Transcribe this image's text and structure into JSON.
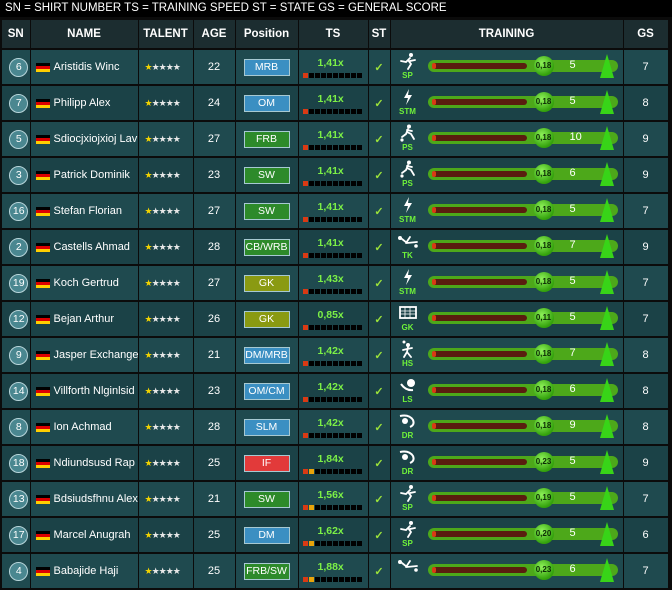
{
  "legend": "SN = SHIRT NUMBER    TS = TRAINING SPEED    ST = STATE    GS = GENERAL SCORE",
  "headers": {
    "sn": "SN",
    "name": "NAME",
    "talent": "TALENT",
    "age": "AGE",
    "position": "Position",
    "ts": "TS",
    "st": "ST",
    "training": "TRAINING",
    "gs": "GS"
  },
  "colors": {
    "pos_blue": "#3b8fc2",
    "pos_green": "#2d8a2a",
    "pos_olive": "#8a9a12",
    "pos_red": "#e23a3a"
  },
  "players": [
    {
      "sn": "6",
      "name": "Aristidis Winc",
      "talent": 1,
      "age": "22",
      "position": "MRB",
      "pos_color": "blue",
      "ts": "1,41x",
      "ts_level": 1,
      "train_icon": "running-icon",
      "train_code": "SP",
      "train_value": "0,18",
      "train_progress": 0.05,
      "train_level": "5",
      "gs": "7"
    },
    {
      "sn": "7",
      "name": "Philipp Alex",
      "talent": 1,
      "age": "24",
      "position": "OM",
      "pos_color": "blue",
      "ts": "1,41x",
      "ts_level": 1,
      "train_icon": "lightning-icon",
      "train_code": "STM",
      "train_value": "0,18",
      "train_progress": 0.05,
      "train_level": "5",
      "gs": "8"
    },
    {
      "sn": "5",
      "name": "Sdiocjxiojxioj Lav",
      "talent": 1,
      "age": "27",
      "position": "FRB",
      "pos_color": "green",
      "ts": "1,41x",
      "ts_level": 1,
      "train_icon": "passing-icon",
      "train_code": "PS",
      "train_value": "0,18",
      "train_progress": 0.05,
      "train_level": "10",
      "gs": "9"
    },
    {
      "sn": "3",
      "name": "Patrick Dominik",
      "talent": 1,
      "age": "23",
      "position": "SW",
      "pos_color": "green",
      "ts": "1,41x",
      "ts_level": 1,
      "train_icon": "passing-icon",
      "train_code": "PS",
      "train_value": "0,18",
      "train_progress": 0.05,
      "train_level": "6",
      "gs": "9"
    },
    {
      "sn": "16",
      "name": "Stefan Florian",
      "talent": 1,
      "age": "27",
      "position": "SW",
      "pos_color": "green",
      "ts": "1,41x",
      "ts_level": 1,
      "train_icon": "lightning-icon",
      "train_code": "STM",
      "train_value": "0,18",
      "train_progress": 0.05,
      "train_level": "5",
      "gs": "7"
    },
    {
      "sn": "2",
      "name": "Castells Ahmad",
      "talent": 1,
      "age": "28",
      "position": "CB/WRB",
      "pos_color": "green",
      "ts": "1,41x",
      "ts_level": 1,
      "train_icon": "tackle-icon",
      "train_code": "TK",
      "train_value": "0,18",
      "train_progress": 0.05,
      "train_level": "7",
      "gs": "9"
    },
    {
      "sn": "19",
      "name": "Koch Gertrud",
      "talent": 1,
      "age": "27",
      "position": "GK",
      "pos_color": "olive",
      "ts": "1,43x",
      "ts_level": 1,
      "train_icon": "lightning-icon",
      "train_code": "STM",
      "train_value": "0,18",
      "train_progress": 0.05,
      "train_level": "5",
      "gs": "7"
    },
    {
      "sn": "12",
      "name": "Bejan Arthur",
      "talent": 1,
      "age": "26",
      "position": "GK",
      "pos_color": "olive",
      "ts": "0,85x",
      "ts_level": 1,
      "train_icon": "goal-icon",
      "train_code": "GK",
      "train_value": "0,11",
      "train_progress": 0.05,
      "train_level": "5",
      "gs": "7"
    },
    {
      "sn": "9",
      "name": "Jasper Exchange",
      "talent": 1,
      "age": "21",
      "position": "DM/MRB",
      "pos_color": "blue",
      "ts": "1,42x",
      "ts_level": 1,
      "train_icon": "header-icon",
      "train_code": "HS",
      "train_value": "0,18",
      "train_progress": 0.05,
      "train_level": "7",
      "gs": "8"
    },
    {
      "sn": "14",
      "name": "Villforth Nlginlsid",
      "talent": 1,
      "age": "23",
      "position": "OM/CM",
      "pos_color": "blue",
      "ts": "1,42x",
      "ts_level": 1,
      "train_icon": "longshot-icon",
      "train_code": "LS",
      "train_value": "0,18",
      "train_progress": 0.05,
      "train_level": "6",
      "gs": "8"
    },
    {
      "sn": "8",
      "name": "Ion Achmad",
      "talent": 1,
      "age": "28",
      "position": "SLM",
      "pos_color": "blue",
      "ts": "1,42x",
      "ts_level": 1,
      "train_icon": "dribbling-icon",
      "train_code": "DR",
      "train_value": "0,18",
      "train_progress": 0.05,
      "train_level": "9",
      "gs": "8"
    },
    {
      "sn": "18",
      "name": "Ndiundsusd Rap",
      "talent": 1,
      "age": "25",
      "position": "IF",
      "pos_color": "red",
      "ts": "1,84x",
      "ts_level": 2,
      "train_icon": "dribbling-icon",
      "train_code": "DR",
      "train_value": "0,23",
      "train_progress": 0.05,
      "train_level": "5",
      "gs": "9"
    },
    {
      "sn": "13",
      "name": "Bdsiudsfhnu Alex",
      "talent": 1,
      "age": "21",
      "position": "SW",
      "pos_color": "green",
      "ts": "1,56x",
      "ts_level": 2,
      "train_icon": "running-icon",
      "train_code": "SP",
      "train_value": "0,19",
      "train_progress": 0.05,
      "train_level": "5",
      "gs": "7"
    },
    {
      "sn": "17",
      "name": "Marcel Anugrah",
      "talent": 1,
      "age": "25",
      "position": "DM",
      "pos_color": "blue",
      "ts": "1,62x",
      "ts_level": 2,
      "train_icon": "running-icon",
      "train_code": "SP",
      "train_value": "0,20",
      "train_progress": 0.05,
      "train_level": "5",
      "gs": "6"
    },
    {
      "sn": "4",
      "name": "Babajide Haji",
      "talent": 1,
      "age": "25",
      "position": "FRB/SW",
      "pos_color": "green",
      "ts": "1,88x",
      "ts_level": 2,
      "train_icon": "tackle-icon",
      "train_code": "",
      "train_value": "0,23",
      "train_progress": 0.05,
      "train_level": "6",
      "gs": "7"
    }
  ]
}
